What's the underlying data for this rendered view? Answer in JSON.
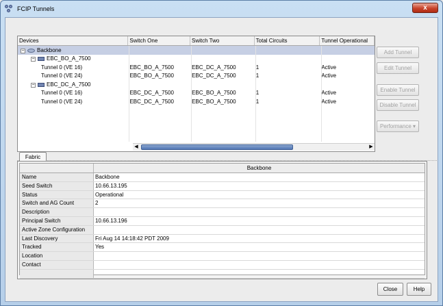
{
  "window": {
    "title": "FCIP Tunnels",
    "close_label": "x"
  },
  "tunnel_table": {
    "columns": [
      "Devices",
      "Switch One",
      "Switch Two",
      "Total Circuits",
      "Tunnel Operational"
    ],
    "rows": [
      {
        "level": 0,
        "expander": "−",
        "icon": "fabric-icon",
        "name": "Backbone",
        "switch_one": "",
        "switch_two": "",
        "circuits": "",
        "status": "",
        "selected": true
      },
      {
        "level": 1,
        "expander": "−",
        "icon": "switch-icon",
        "name": "EBC_BO_A_7500",
        "switch_one": "",
        "switch_two": "",
        "circuits": "",
        "status": ""
      },
      {
        "level": 2,
        "expander": "",
        "icon": "",
        "name": "Tunnel 0 (VE 16)",
        "switch_one": "EBC_BO_A_7500",
        "switch_two": "EBC_DC_A_7500",
        "circuits": "1",
        "status": "Active"
      },
      {
        "level": 2,
        "expander": "",
        "icon": "",
        "name": "Tunnel 0 (VE 24)",
        "switch_one": "EBC_BO_A_7500",
        "switch_two": "EBC_DC_A_7500",
        "circuits": "1",
        "status": "Active"
      },
      {
        "level": 1,
        "expander": "−",
        "icon": "switch-icon",
        "name": "EBC_DC_A_7500",
        "switch_one": "",
        "switch_two": "",
        "circuits": "",
        "status": ""
      },
      {
        "level": 2,
        "expander": "",
        "icon": "",
        "name": "Tunnel 0 (VE 16)",
        "switch_one": "EBC_DC_A_7500",
        "switch_two": "EBC_BO_A_7500",
        "circuits": "1",
        "status": "Active"
      },
      {
        "level": 2,
        "expander": "",
        "icon": "",
        "name": "Tunnel 0 (VE 24)",
        "switch_one": "EBC_DC_A_7500",
        "switch_two": "EBC_BO_A_7500",
        "circuits": "1",
        "status": "Active"
      }
    ]
  },
  "side_buttons": {
    "add_tunnel": "Add Tunnel",
    "edit_tunnel": "Edit Tunnel",
    "enable_tunnel": "Enable Tunnel",
    "disable_tunnel": "Disable Tunnel",
    "performance": "Performance"
  },
  "fabric_tab": {
    "tab_label": "Fabric",
    "column_header": "Backbone",
    "properties": [
      {
        "key": "Name",
        "value": "Backbone"
      },
      {
        "key": "Seed Switch",
        "value": "10.66.13.195"
      },
      {
        "key": "Status",
        "value": "Operational"
      },
      {
        "key": "Switch and AG Count",
        "value": "2"
      },
      {
        "key": "Description",
        "value": ""
      },
      {
        "key": "Principal Switch",
        "value": "10.66.13.196"
      },
      {
        "key": "Active Zone Configuration",
        "value": ""
      },
      {
        "key": "Last Discovery",
        "value": "Fri Aug 14 14:18:42 PDT 2009"
      },
      {
        "key": "Tracked",
        "value": "Yes"
      },
      {
        "key": "Location",
        "value": ""
      },
      {
        "key": "Contact",
        "value": ""
      },
      {
        "key": "",
        "value": ""
      }
    ]
  },
  "footer": {
    "close": "Close",
    "help": "Help"
  }
}
